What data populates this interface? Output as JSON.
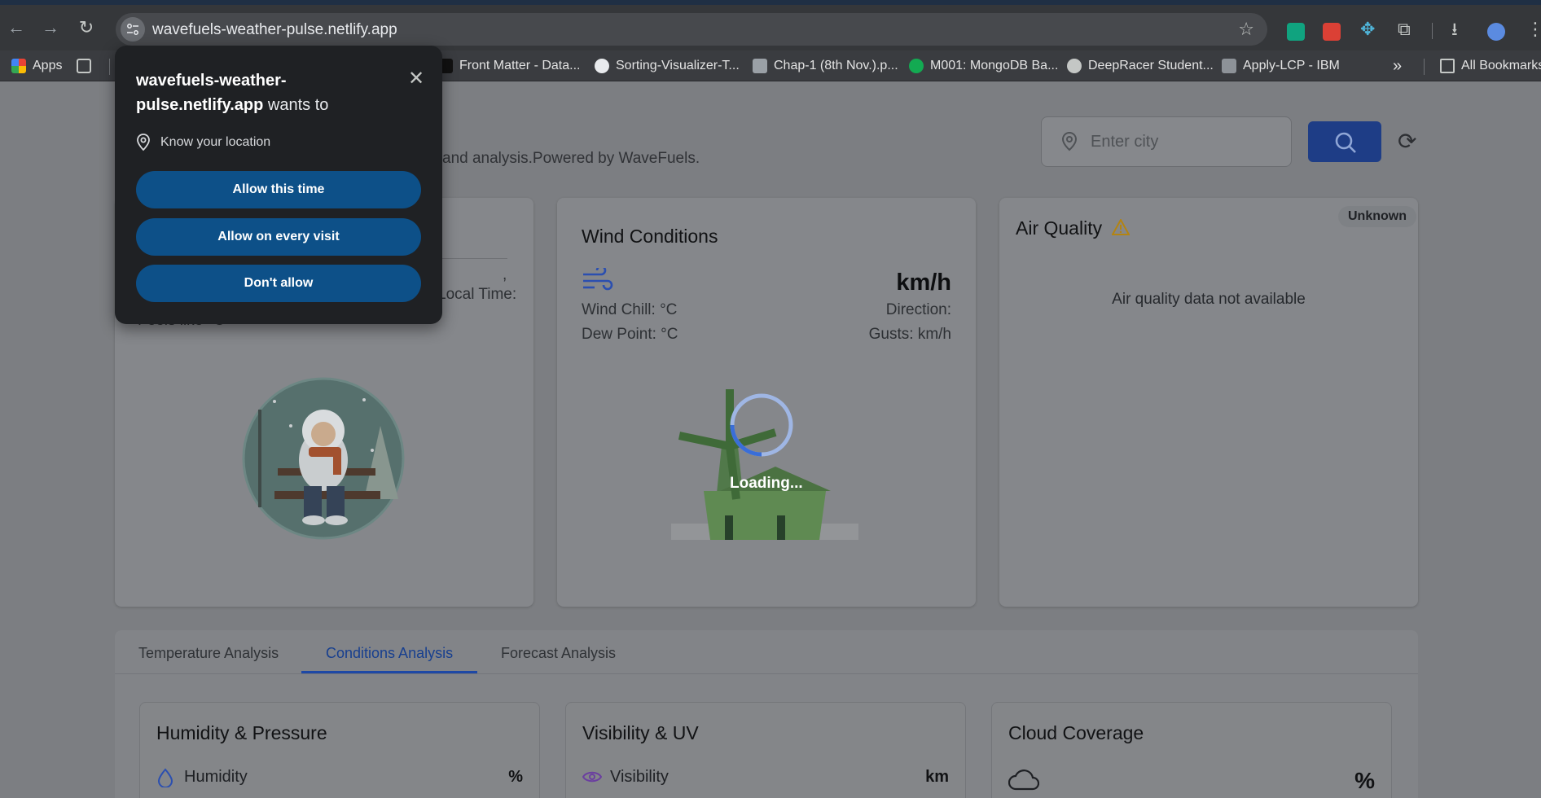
{
  "browser": {
    "url": "wavefuels-weather-pulse.netlify.app",
    "bookmarks": [
      {
        "label": "Apps"
      },
      {
        "label": "Front Matter - Data..."
      },
      {
        "label": "Sorting-Visualizer-T..."
      },
      {
        "label": "Chap-1 (8th Nov.).p..."
      },
      {
        "label": "M001: MongoDB Ba..."
      },
      {
        "label": "DeepRacer Student..."
      },
      {
        "label": "Apply-LCP - IBM"
      }
    ],
    "more": "»",
    "all_bookmarks": "All Bookmarks"
  },
  "permission_popup": {
    "site": "wavefuels-weather-pulse.netlify.app",
    "suffix": "wants to",
    "permission": "Know your location",
    "buttons": [
      "Allow this time",
      "Allow on every visit",
      "Don't allow"
    ]
  },
  "header": {
    "subtitle_visible": "and analysis.Powered by WaveFuels.",
    "city_placeholder": "Enter city"
  },
  "current_card": {
    "comma": ",",
    "local_time": "Local Time:",
    "feels_like": "Feels like °C"
  },
  "wind_card": {
    "title": "Wind Conditions",
    "speed_unit": "km/h",
    "wind_chill": "Wind Chill: °C",
    "dew_point": "Dew Point: °C",
    "direction": "Direction:",
    "gusts": "Gusts: km/h",
    "loading": "Loading..."
  },
  "air_card": {
    "title": "Air Quality",
    "badge": "Unknown",
    "message": "Air quality data not available"
  },
  "tabs": {
    "items": [
      "Temperature Analysis",
      "Conditions Analysis",
      "Forecast Analysis"
    ],
    "active": "Conditions Analysis"
  },
  "subcards": [
    {
      "title": "Humidity & Pressure",
      "label": "Humidity",
      "unit": "%"
    },
    {
      "title": "Visibility & UV",
      "label": "Visibility",
      "unit": "km"
    },
    {
      "title": "Cloud Coverage",
      "label": "",
      "unit": "%"
    }
  ],
  "colors": {
    "accent": "#1e48a5",
    "popup_button": "#0d5088",
    "warning": "#d9a213"
  }
}
